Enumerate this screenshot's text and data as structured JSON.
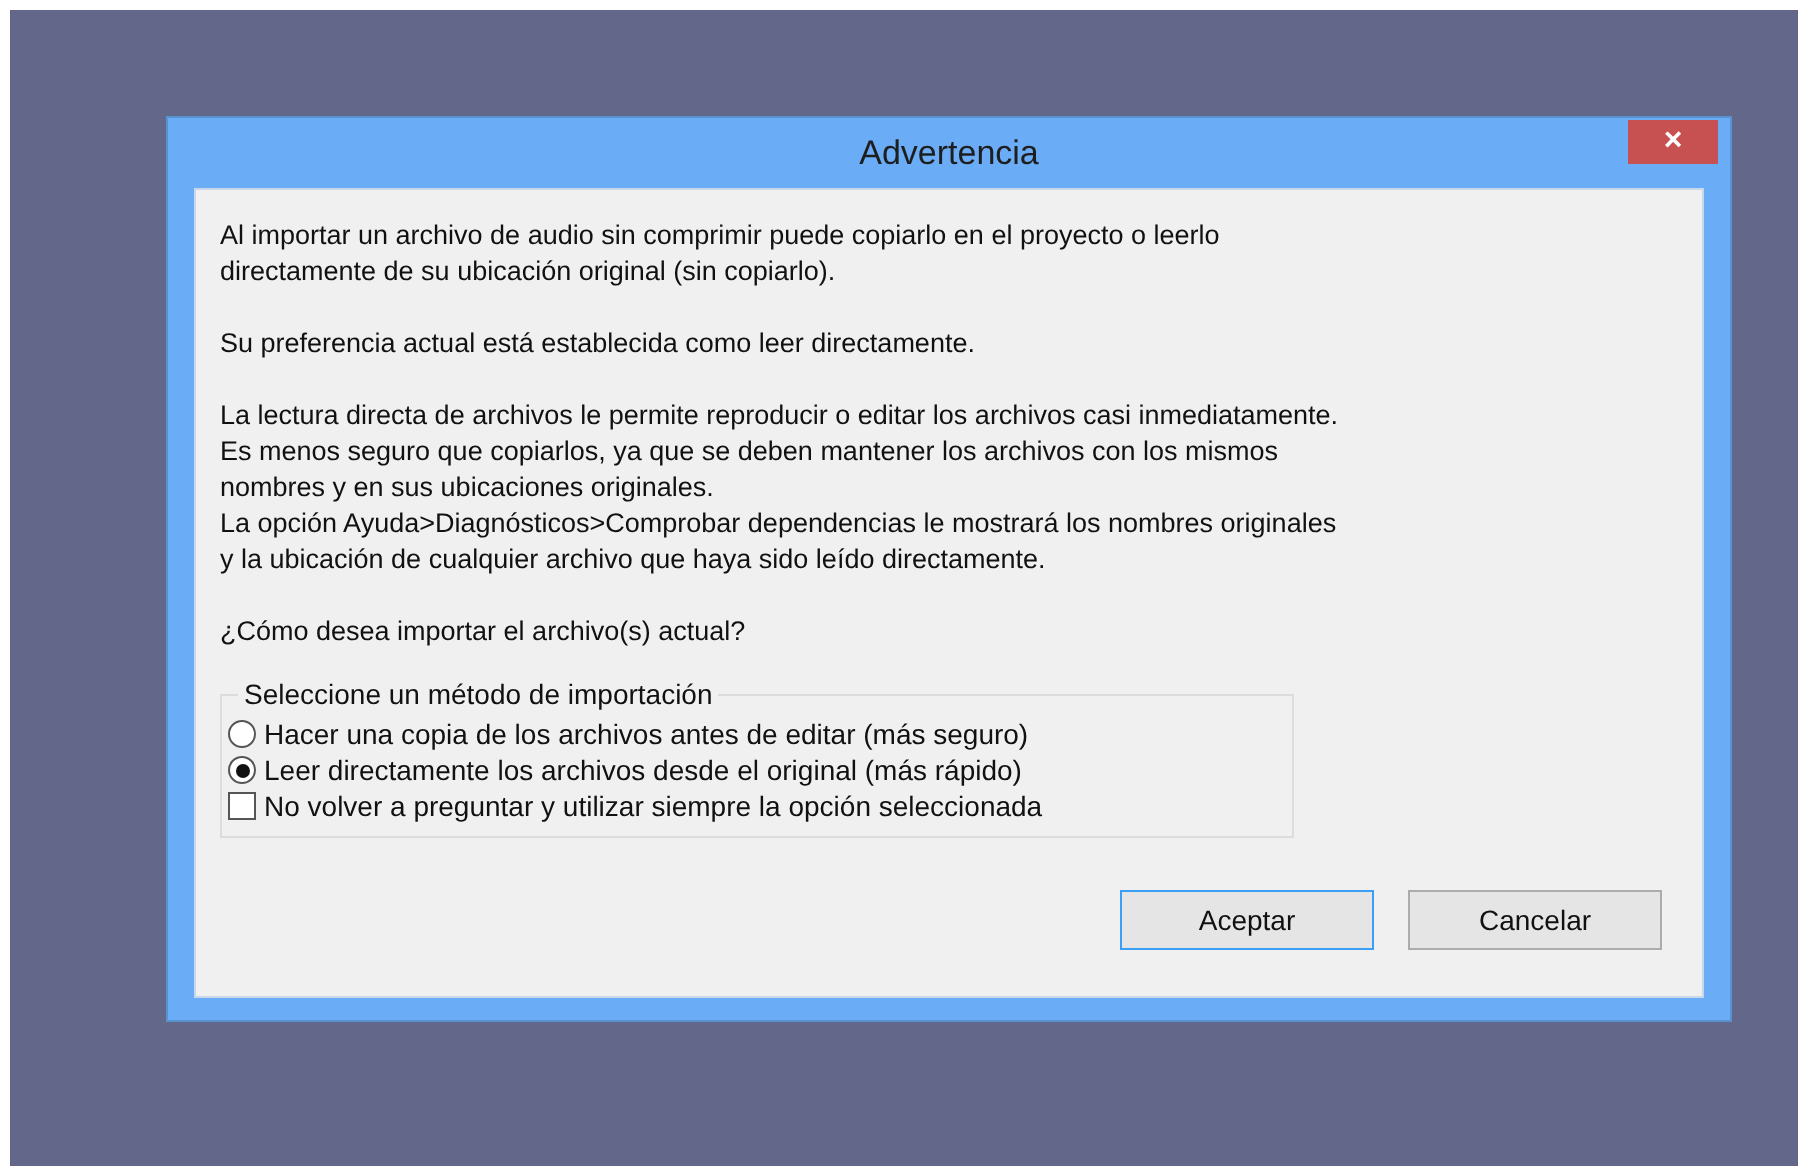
{
  "window": {
    "title": "Advertencia",
    "close": "×"
  },
  "paragraphs": [
    {
      "lines": [
        "Al importar un archivo de audio sin comprimir puede copiarlo en el proyecto o leerlo",
        "directamente de su ubicación original (sin copiarlo)."
      ]
    },
    {
      "lines": [
        "Su preferencia actual está establecida como leer directamente."
      ]
    },
    {
      "lines": [
        "La lectura directa de archivos le permite reproducir o editar los archivos casi inmediatamente.",
        "Es menos seguro que copiarlos, ya que se deben mantener los archivos con los mismos",
        "nombres y en sus ubicaciones originales.",
        "La opción Ayuda>Diagnósticos>Comprobar dependencias le mostrará los nombres originales",
        "y la ubicación de cualquier archivo que haya sido leído directamente."
      ]
    },
    {
      "lines": [
        "¿Cómo desea importar el archivo(s) actual?"
      ]
    }
  ],
  "group": {
    "title": "Seleccione un método de importación",
    "options": [
      {
        "kind": "radio",
        "label": "Hacer una copia de los archivos antes de editar (más seguro)",
        "selected": false
      },
      {
        "kind": "radio",
        "label": "Leer directamente los archivos desde el original (más rápido)",
        "selected": true
      },
      {
        "kind": "checkbox",
        "label": "No volver a preguntar y utilizar siempre la opción seleccionada",
        "checked": false
      }
    ]
  },
  "buttons": [
    {
      "label": "Aceptar",
      "default": true
    },
    {
      "label": "Cancelar",
      "default": false
    }
  ]
}
